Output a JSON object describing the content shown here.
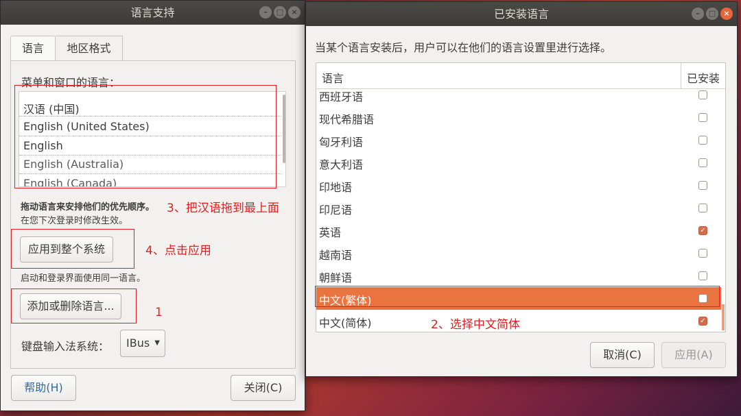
{
  "left_window": {
    "title": "语言支持",
    "tabs": [
      "语言",
      "地区格式"
    ],
    "menu_lang_heading": "菜单和窗口的语言：",
    "languages": [
      "汉语 (中国)",
      "English (United States)",
      "English",
      "English (Australia)",
      "English (Canada)"
    ],
    "drag_hint_bold": "拖动语言来安排他们的优先顺序。",
    "drag_hint_sub": "在您下次登录时修改生效。",
    "apply_system_button": "应用到整个系统",
    "login_hint": "启动和登录界面使用同一语言。",
    "add_remove_button": "添加或删除语言...",
    "input_method_label": "键盘输入法系统：",
    "input_method_value": "IBus",
    "help_button": "帮助(H)",
    "close_button": "关闭(C)"
  },
  "right_window": {
    "title": "已安装语言",
    "description": "当某个语言安装后，用户可以在他们的语言设置里进行选择。",
    "col_language": "语言",
    "col_installed": "已安装",
    "rows": [
      {
        "name": "西班牙语",
        "installed": false
      },
      {
        "name": "现代希腊语",
        "installed": false
      },
      {
        "name": "匈牙利语",
        "installed": false
      },
      {
        "name": "意大利语",
        "installed": false
      },
      {
        "name": "印地语",
        "installed": false
      },
      {
        "name": "印尼语",
        "installed": false
      },
      {
        "name": "英语",
        "installed": true
      },
      {
        "name": "越南语",
        "installed": false
      },
      {
        "name": "朝鲜语",
        "installed": false
      },
      {
        "name": "中文(繁体)",
        "installed": false,
        "selected": true
      },
      {
        "name": "中文(简体)",
        "installed": true
      }
    ],
    "cancel_button": "取消(C)",
    "apply_button": "应用(A)"
  },
  "annotations": {
    "step1": "1",
    "step2": "2、选择中文简体",
    "step3": "3、把汉语拖到最上面",
    "step4": "4、点击应用"
  },
  "colors": {
    "selection": "#e9743f",
    "annotation": "#e02020",
    "titlebar": "#3c3b37"
  }
}
